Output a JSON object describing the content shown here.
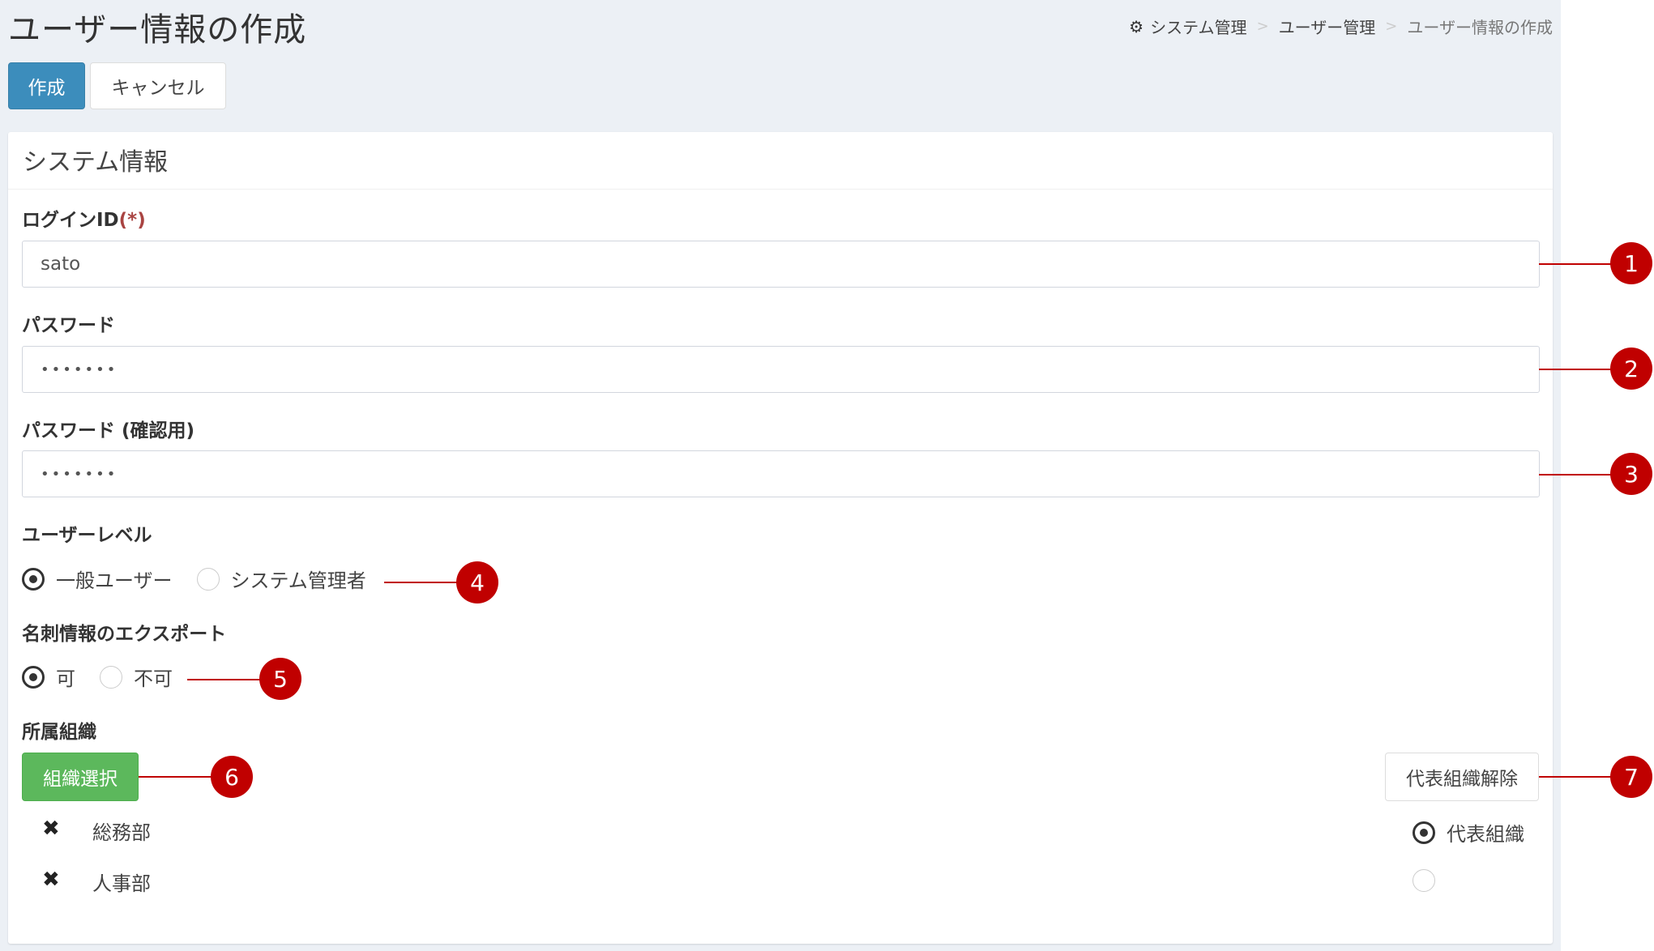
{
  "header": {
    "title": "ユーザー情報の作成",
    "breadcrumb": [
      "システム管理",
      "ユーザー管理",
      "ユーザー情報の作成"
    ]
  },
  "toolbar": {
    "create_label": "作成",
    "cancel_label": "キャンセル"
  },
  "section": {
    "title": "システム情報",
    "login_id": {
      "label": "ログインID",
      "required_mark": "(*)",
      "value": "sato"
    },
    "password": {
      "label": "パスワード",
      "value": "•••••••"
    },
    "password_confirm": {
      "label": "パスワード (確認用)",
      "value": "•••••••"
    },
    "user_level": {
      "label": "ユーザーレベル",
      "options": [
        "一般ユーザー",
        "システム管理者"
      ],
      "selected": "一般ユーザー"
    },
    "export": {
      "label": "名刺情報のエクスポート",
      "options": [
        "可",
        "不可"
      ],
      "selected": "可"
    },
    "org": {
      "label": "所属組織",
      "select_label": "組織選択",
      "unset_label": "代表組織解除",
      "items": [
        {
          "name": "総務部",
          "representative_label": "代表組織",
          "is_representative": true
        },
        {
          "name": "人事部",
          "representative_label": "",
          "is_representative": false
        }
      ]
    }
  },
  "callouts": [
    "1",
    "2",
    "3",
    "4",
    "5",
    "6",
    "7"
  ],
  "colors": {
    "primary": "#3c8dbc",
    "success": "#5cb85c",
    "callout": "#c00000",
    "background": "#ecf0f5"
  }
}
